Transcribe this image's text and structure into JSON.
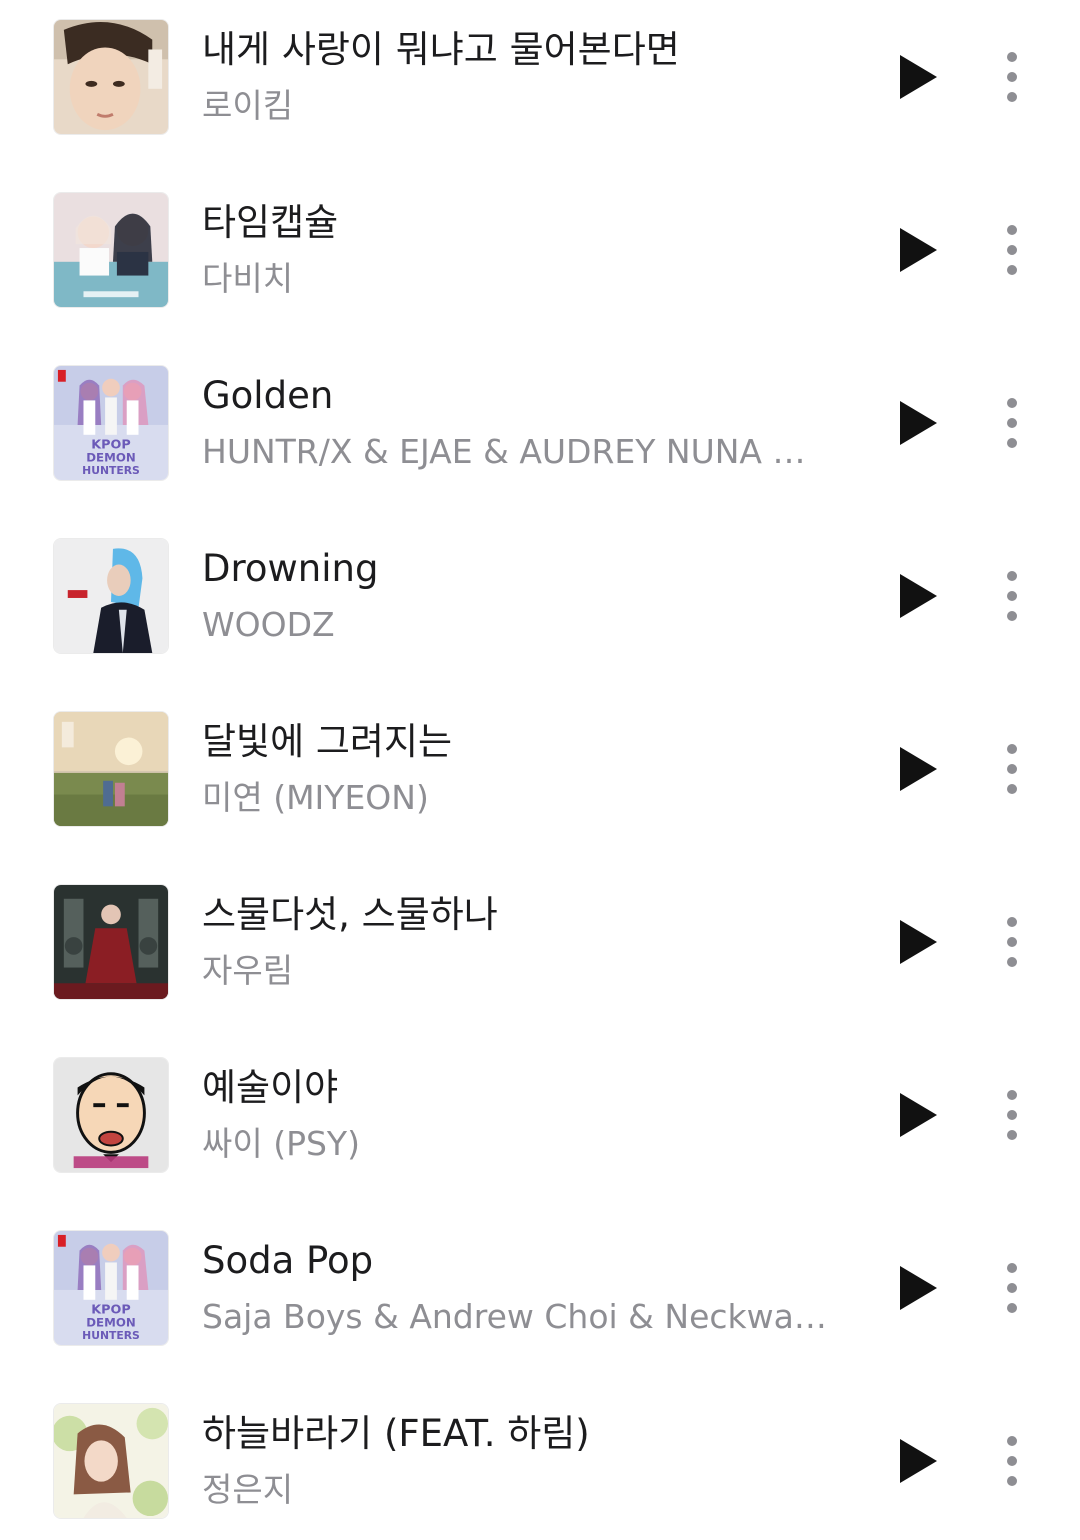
{
  "colors": {
    "title": "#1c1c1e",
    "artist": "#8e8e93",
    "play_icon": "#111111",
    "more_icon": "#8e8e93"
  },
  "tracks": [
    {
      "title": "내게 사랑이 뭐냐고 물어본다면",
      "artist": "로이킴",
      "art": "portrait-warm"
    },
    {
      "title": "타임캡슐",
      "artist": "다비치",
      "art": "duo-pastel"
    },
    {
      "title": "Golden",
      "artist": "HUNTR/X & EJAE & AUDREY NUNA &…",
      "art": "kpop-demon-hunters"
    },
    {
      "title": "Drowning",
      "artist": "WOODZ",
      "art": "blue-hair-white"
    },
    {
      "title": "달빛에 그려지는",
      "artist": "미연 (MIYEON)",
      "art": "sunset-field"
    },
    {
      "title": "스물다섯, 스물하나",
      "artist": "자우림",
      "art": "dark-room-red"
    },
    {
      "title": "예술이야",
      "artist": "싸이 (PSY)",
      "art": "cartoon-face"
    },
    {
      "title": "Soda Pop",
      "artist": "Saja Boys & Andrew Choi & Neckwav…",
      "art": "kpop-demon-hunters"
    },
    {
      "title": "하늘바라기 (FEAT. 하림)",
      "artist": "정은지",
      "art": "portrait-green"
    }
  ],
  "icons": {
    "play": "play-icon",
    "more": "more-vertical-icon"
  }
}
